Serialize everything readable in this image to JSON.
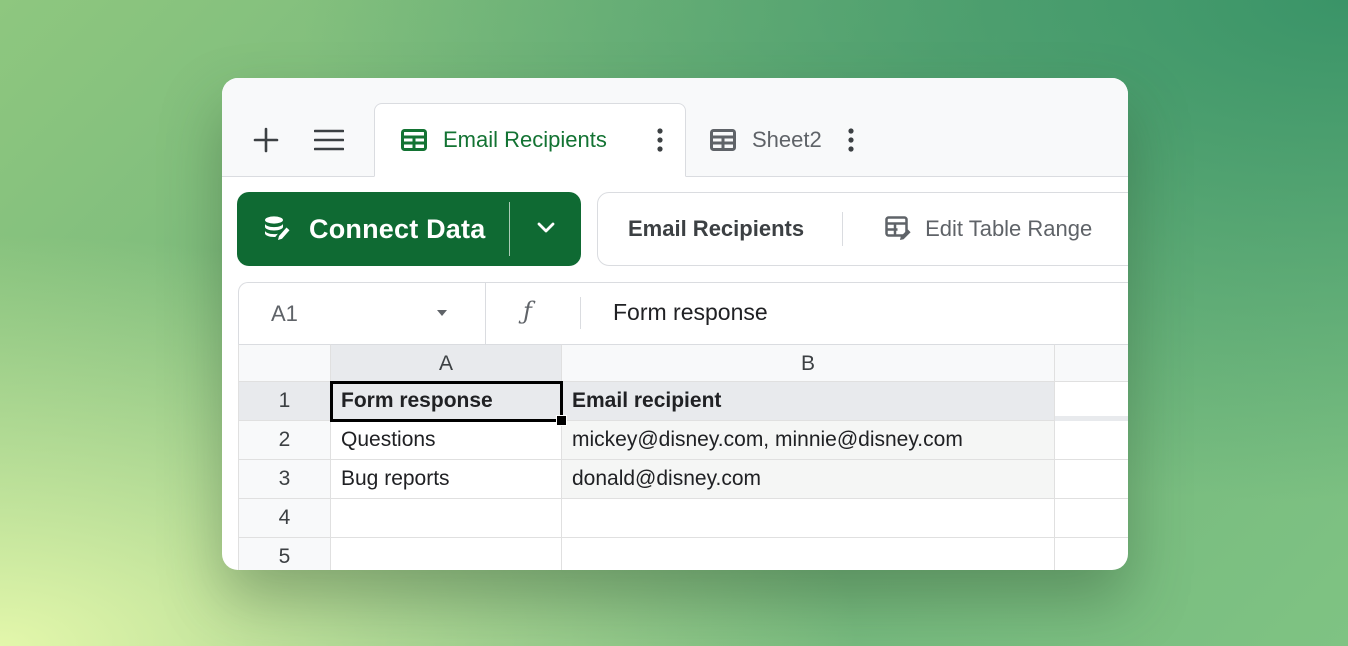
{
  "tabbar": {
    "add_icon": "plus-icon",
    "menu_icon": "hamburger-menu-icon",
    "tabs": [
      {
        "label": "Email Recipients",
        "icon": "table-grid-icon",
        "active": true
      },
      {
        "label": "Sheet2",
        "icon": "table-grid-icon",
        "active": false
      }
    ]
  },
  "toolbar": {
    "connect_label": "Connect Data",
    "connect_icon": "database-edit-icon",
    "dropdown_icon": "chevron-down-icon",
    "table_name": "Email Recipients",
    "edit_range_label": "Edit Table Range",
    "edit_range_icon": "table-edit-icon"
  },
  "formula_bar": {
    "name_box": "A1",
    "fx_symbol": "ƒ",
    "value": "Form response"
  },
  "sheet": {
    "columns": [
      "A",
      "B",
      ""
    ],
    "row_numbers": [
      "1",
      "2",
      "3",
      "4",
      "5"
    ],
    "rows": [
      [
        "Form response",
        "Email recipient",
        ""
      ],
      [
        "Questions",
        "mickey@disney.com, minnie@disney.com",
        ""
      ],
      [
        "Bug reports",
        "donald@disney.com",
        ""
      ],
      [
        "",
        "",
        ""
      ],
      [
        "",
        "",
        ""
      ]
    ],
    "selected_cell": "A1"
  },
  "colors": {
    "brand_green": "#0f6a33",
    "active_tab_text": "#137333"
  }
}
